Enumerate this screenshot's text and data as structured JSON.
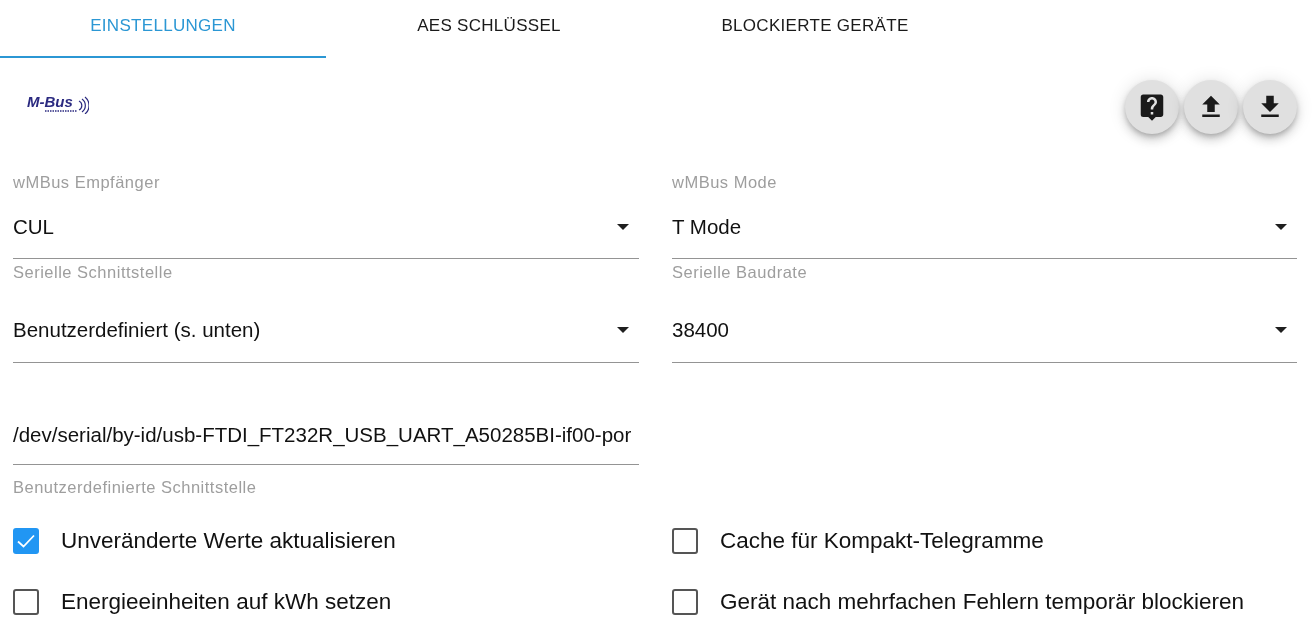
{
  "tabs": [
    {
      "label": "EINSTELLUNGEN",
      "selected": true
    },
    {
      "label": "AES SCHLÜSSEL",
      "selected": false
    },
    {
      "label": "BLOCKIERTE GERÄTE",
      "selected": false
    }
  ],
  "logo": {
    "text": "M-Bus"
  },
  "fields": [
    {
      "kind": "select",
      "label": "wMBus Empfänger",
      "value": "CUL"
    },
    {
      "kind": "select",
      "label": "wMBus Mode",
      "value": "T Mode"
    },
    {
      "kind": "select",
      "label": "Serielle Schnittstelle",
      "value": "Benutzerdefiniert (s. unten)"
    },
    {
      "kind": "select",
      "label": "Serielle Baudrate",
      "value": "38400"
    },
    {
      "kind": "text",
      "value": "/dev/serial/by-id/usb-FTDI_FT232R_USB_UART_A50285BI-if00-por",
      "helper": "Benutzerdefinierte Schnittstelle"
    }
  ],
  "checkboxes": [
    {
      "label": "Unveränderte Werte aktualisieren",
      "checked": true
    },
    {
      "label": "Cache für Kompakt-Telegramme",
      "checked": false
    },
    {
      "label": "Energieeinheiten auf kWh setzen",
      "checked": false
    },
    {
      "label": "Gerät nach mehrfachen Fehlern temporär blockieren",
      "checked": false
    }
  ]
}
